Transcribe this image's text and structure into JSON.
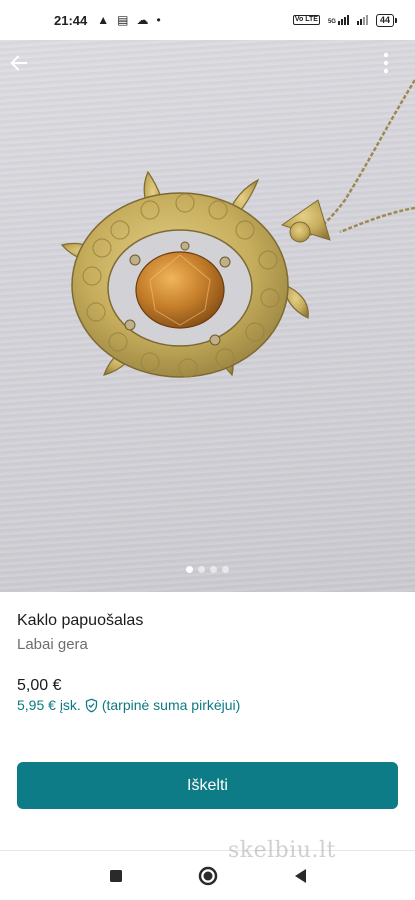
{
  "status_bar": {
    "time": "21:44",
    "network_label": "5G",
    "volte_label": "Vo LTE",
    "battery": "44"
  },
  "icons": {
    "back": "arrow-left-icon",
    "more": "more-vertical-icon",
    "shield": "shield-check-icon",
    "nav_recents": "square-icon",
    "nav_home": "circle-icon",
    "nav_back": "triangle-left-icon"
  },
  "carousel": {
    "count": 4,
    "active_index": 0
  },
  "listing": {
    "title": "Kaklo papuošalas",
    "condition": "Labai gera",
    "price": "5,00 €",
    "buyer_total": "5,95 € įsk.",
    "buyer_note": "(tarpinė suma pirkėjui)"
  },
  "actions": {
    "bump_label": "Iškelti"
  },
  "watermark": "skelbiu.lt",
  "colors": {
    "accent": "#0e7c86",
    "accent_text": "#0d7a82"
  }
}
